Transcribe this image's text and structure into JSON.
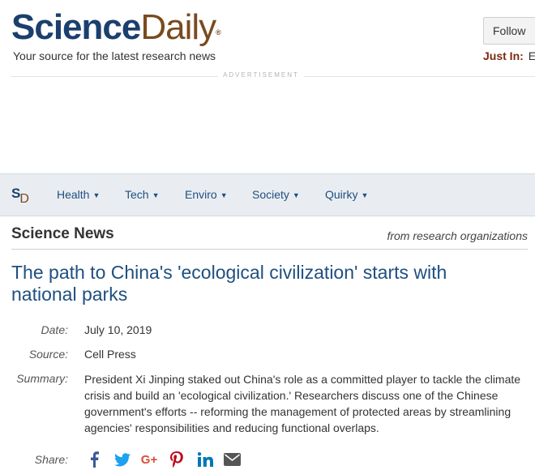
{
  "brand": {
    "logo_part1": "Science",
    "logo_part2": "Daily",
    "logo_mark": "®",
    "tagline": "Your source for the latest research news"
  },
  "header": {
    "follow_label": "Follow",
    "just_in_label": "Just In:",
    "just_in_text": "E"
  },
  "advertisement_label": "ADVERTISEMENT",
  "nav": {
    "logo_s": "S",
    "logo_d": "D",
    "items": [
      {
        "label": "Health"
      },
      {
        "label": "Tech"
      },
      {
        "label": "Enviro"
      },
      {
        "label": "Society"
      },
      {
        "label": "Quirky"
      }
    ]
  },
  "section": {
    "title": "Science News",
    "subtitle": "from research organizations"
  },
  "article": {
    "headline": "The path to China's 'ecological civilization' starts with national parks",
    "date_label": "Date:",
    "date": "July 10, 2019",
    "source_label": "Source:",
    "source": "Cell Press",
    "summary_label": "Summary:",
    "summary": "President Xi Jinping staked out China's role as a committed player to tackle the climate crisis and build an 'ecological civilization.' Researchers discuss one of the Chinese government's efforts -- reforming the management of protected areas by streamlining agencies' responsibilities and reducing functional overlaps."
  },
  "share": {
    "label": "Share:",
    "icons": [
      "facebook-icon",
      "twitter-icon",
      "google-plus-icon",
      "pinterest-icon",
      "linkedin-icon",
      "email-icon"
    ]
  },
  "colors": {
    "brand_blue": "#1b3f6e",
    "brand_brown": "#7a4a1e",
    "link_blue": "#1f4f80",
    "nav_bg": "#e9edf1",
    "just_in": "#7a2a10"
  }
}
